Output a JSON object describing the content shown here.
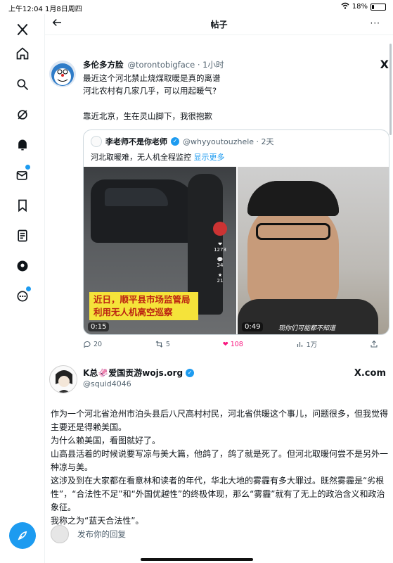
{
  "status_bar": {
    "time": "上午12:04 1月8日周四",
    "battery": "18%",
    "battery_level": 0.18
  },
  "nav": {
    "items": [
      "x-logo-icon",
      "home-icon",
      "search-icon",
      "grok-icon",
      "notifications-icon",
      "messages-icon",
      "bookmarks-icon",
      "lists-icon",
      "profile-icon",
      "more-icon"
    ],
    "compose": "compose-icon"
  },
  "header": {
    "title": "帖子",
    "more": "···"
  },
  "tweet": {
    "name": "多伦多方脸",
    "handle": "@torontobigface · 1小时",
    "lines": [
      "最近这个河北禁止烧煤取暖是真的离谱",
      "河北农村有几家几乎，可以用起暖气?",
      "靠近北京，生在灵山脚下，我很抱歉"
    ],
    "x_badge": "X",
    "quote": {
      "name": "李老师不是你老师",
      "handle": "@whyyoutouzhele · 2天",
      "text": "河北取暖难，无人机全程监控",
      "show_more": "显示更多",
      "video1": {
        "banner_line1": "近日，顺平县市场监管局",
        "banner_line2": "利用无人机高空巡察",
        "duration": "0:15",
        "likes": "1273",
        "comments": "34",
        "favs": "21"
      },
      "video2": {
        "subtitle": "现你们可能都不知道",
        "duration": "0:49"
      }
    },
    "actions": {
      "replies": "20",
      "retweets": "5",
      "likes": "108",
      "views": "1万"
    }
  },
  "post": {
    "name": "K总🦑爱国贡游wojs.org",
    "handle": "@squid4046",
    "source": "X.com",
    "paragraphs": [
      "作为一个河北省沧州市泊头县后八尺高村村民，河北省供暖这个事儿，问题很多，但我觉得主要还是得赖美国。",
      "为什么赖美国，看图就好了。",
      "山高县活着的时候说要写凉与美大篇，他鸽了，鸽了就是死了。但河北取暖何尝不是另外一种凉与美。",
      "这涉及到在大家都在看意林和读者的年代，华北大地的雾霾有多大罪过。既然雾霾是“劣根性”，“合法性不足”和“外国优越性”的终极体现，那么“雾霾”就有了无上的政治含义和政治象征。",
      "我称之为“蓝天合法性”。"
    ]
  },
  "reply": {
    "placeholder": "发布你的回复"
  }
}
